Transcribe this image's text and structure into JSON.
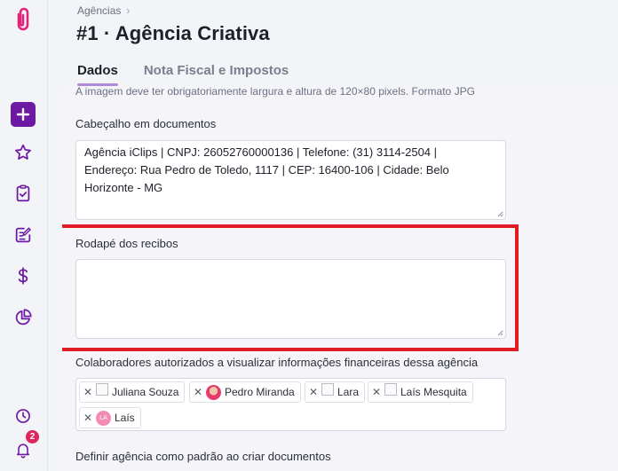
{
  "breadcrumb": {
    "parent": "Agências"
  },
  "page": {
    "title": "#1 · Agência Criativa"
  },
  "tabs": [
    {
      "label": "Dados",
      "active": true
    },
    {
      "label": "Nota Fiscal e Impostos",
      "active": false
    }
  ],
  "form": {
    "image_helper": "A imagem deve ter obrigatoriamente largura e altura de 120×80 pixels. Formato JPG",
    "header_label": "Cabeçalho em documentos",
    "header_value_line1": "Agência iClips | CNPJ: 26052760000136 | Telefone: (31) 3114-2504 |",
    "header_value_line2": "Endereço: Rua Pedro de Toledo, 1117  |  CEP: 16400-106 | Cidade: Belo",
    "header_value_line3": "Horizonte - MG",
    "footer_label": "Rodapé dos recibos",
    "footer_value": "",
    "collaborators_label": "Colaboradores autorizados a visualizar informações financeiras dessa agência",
    "collaborators": [
      {
        "name": "Juliana Souza",
        "avatar": "broken-image-icon"
      },
      {
        "name": "Pedro Miranda",
        "avatar": "photo"
      },
      {
        "name": "Lara",
        "avatar": "broken-image-icon"
      },
      {
        "name": "Laís Mesquita",
        "avatar": "broken-image-icon"
      },
      {
        "name": "Laís",
        "avatar": "initials",
        "initials": "LA"
      }
    ],
    "default_agency_label": "Definir agência como padrão ao criar documentos"
  },
  "sidebar": {
    "items": [
      "logo-icon",
      "plus-icon",
      "star-icon",
      "clipboard-check-icon",
      "edit-note-icon",
      "dollar-icon",
      "pie-chart-icon",
      "clock-icon",
      "bell-icon"
    ],
    "notifications_count": "2"
  },
  "colors": {
    "accent": "#6c1aa3",
    "logo": "#e0247a",
    "highlight": "#e01b24",
    "badge": "#e0245e"
  }
}
